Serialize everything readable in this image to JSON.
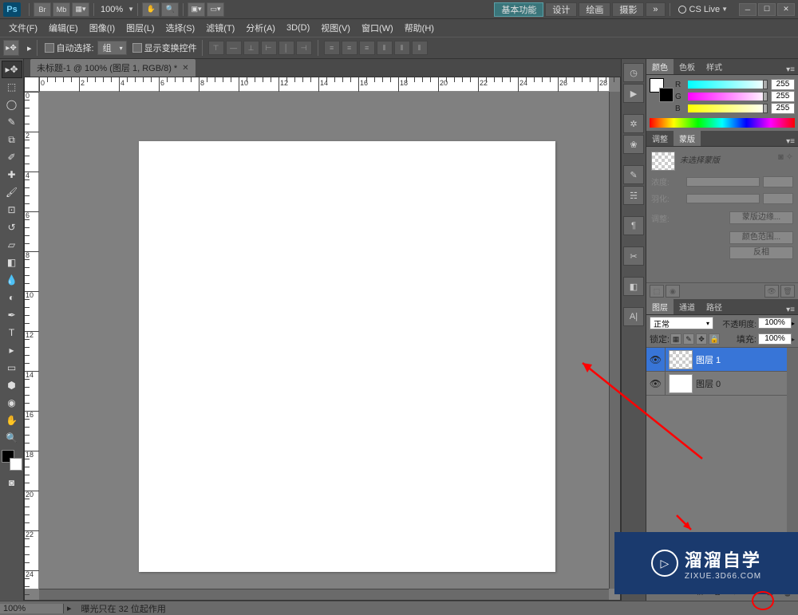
{
  "topbar": {
    "ps": "Ps",
    "zoom": "100%",
    "workspaces": [
      "基本功能",
      "设计",
      "绘画",
      "摄影"
    ],
    "more": "»",
    "cslive": "CS Live"
  },
  "menu": [
    "文件(F)",
    "编辑(E)",
    "图像(I)",
    "图层(L)",
    "选择(S)",
    "滤镜(T)",
    "分析(A)",
    "3D(D)",
    "视图(V)",
    "窗口(W)",
    "帮助(H)"
  ],
  "options": {
    "auto_select": "自动选择:",
    "group": "组",
    "show_transform": "显示变换控件"
  },
  "doc_tab": "未标题-1 @ 100% (图层 1, RGB/8) *",
  "ruler_h": [
    "0",
    "2",
    "4",
    "6",
    "8",
    "10",
    "12",
    "14",
    "16",
    "18",
    "20",
    "22",
    "24",
    "26",
    "28"
  ],
  "ruler_v": [
    "0",
    "2",
    "4",
    "6",
    "8",
    "10",
    "12",
    "14",
    "16",
    "18",
    "20",
    "22",
    "24"
  ],
  "color": {
    "tabs": [
      "颜色",
      "色板",
      "样式"
    ],
    "channels": [
      {
        "l": "R",
        "v": "255"
      },
      {
        "l": "G",
        "v": "255"
      },
      {
        "l": "B",
        "v": "255"
      }
    ]
  },
  "adjust": {
    "tabs": [
      "调整",
      "蒙版"
    ],
    "mask_label": "未选择蒙版",
    "density": "浓度:",
    "feather": "羽化:",
    "adjustments": "调整:",
    "btn_edge": "蒙版边缘...",
    "btn_range": "颜色范围...",
    "btn_invert": "反相"
  },
  "layers": {
    "tabs": [
      "图层",
      "通道",
      "路径"
    ],
    "blend": "正常",
    "opacity_lbl": "不透明度:",
    "opacity_val": "100%",
    "lock_lbl": "锁定:",
    "fill_lbl": "填充:",
    "fill_val": "100%",
    "items": [
      {
        "name": "图层 1"
      },
      {
        "name": "图层 0"
      }
    ]
  },
  "status": {
    "zoom": "100%",
    "info": "曝光只在 32 位起作用"
  },
  "watermark": {
    "big": "溜溜自学",
    "small": "ZIXUE.3D66.COM"
  }
}
